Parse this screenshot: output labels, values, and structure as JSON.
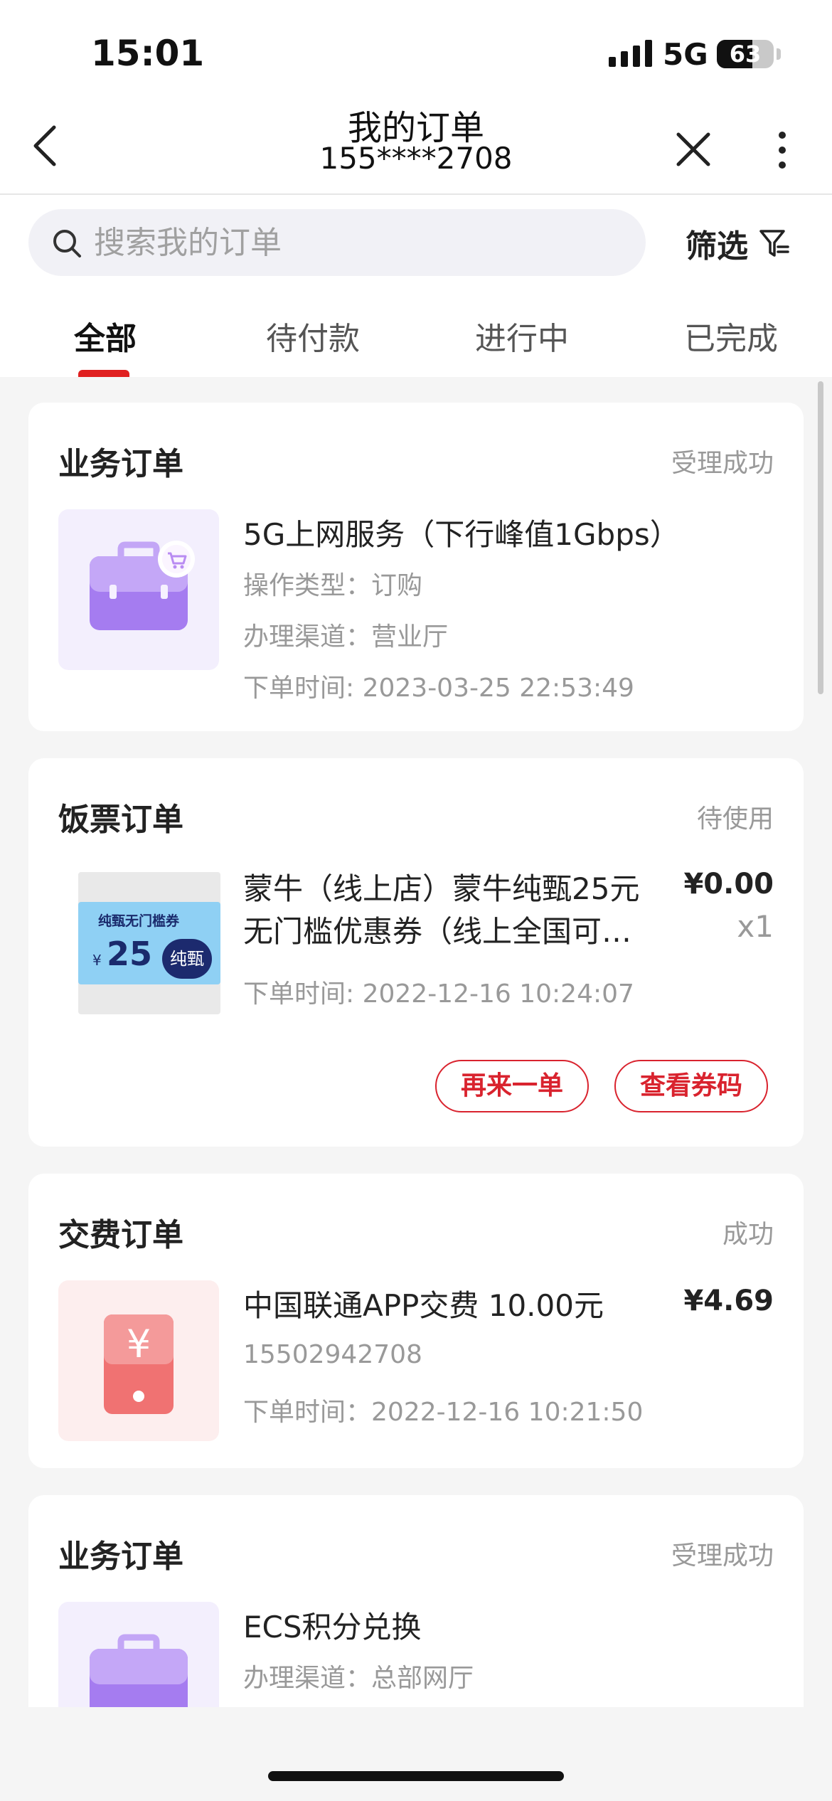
{
  "status_bar": {
    "time": "15:01",
    "network": "5G",
    "battery": "63",
    "battery_level": 0.63
  },
  "nav": {
    "title": "我的订单",
    "subtitle": "155****2708"
  },
  "search": {
    "placeholder": "搜索我的订单",
    "value": ""
  },
  "filter": {
    "label": "筛选"
  },
  "tabs": [
    {
      "label": "全部",
      "active": true
    },
    {
      "label": "待付款",
      "active": false
    },
    {
      "label": "进行中",
      "active": false
    },
    {
      "label": "已完成",
      "active": false
    }
  ],
  "orders": [
    {
      "type": "业务订单",
      "status": "受理成功",
      "icon": "briefcase-cart-icon",
      "name": "5G上网服务（下行峰值1Gbps）",
      "lines": [
        "操作类型：订购",
        "办理渠道：营业厅",
        "下单时间: 2023-03-25 22:53:49"
      ]
    },
    {
      "type": "饭票订单",
      "status": "待使用",
      "icon": "coupon-image",
      "coupon": {
        "heading": "纯甄无门槛券",
        "currency": "¥",
        "amount": "25",
        "brand": "纯甄"
      },
      "name_line1": "蒙牛（线上店）蒙牛纯甄25元",
      "name_line2": "无门槛优惠券（线上全国可…",
      "price": "¥0.00",
      "qty": "x1",
      "time": "下单时间: 2022-12-16 10:24:07",
      "buttons": [
        "再来一单",
        "查看券码"
      ]
    },
    {
      "type": "交费订单",
      "status": "成功",
      "icon": "phone-yuan-icon",
      "name": "中国联通APP交费 10.00元",
      "price": "¥4.69",
      "lines": [
        "15502942708",
        "下单时间：2022-12-16 10:21:50"
      ]
    },
    {
      "type": "业务订单",
      "status": "受理成功",
      "icon": "briefcase-icon",
      "name": "ECS积分兑换",
      "lines": [
        "办理渠道：总部网厅"
      ]
    }
  ],
  "colors": {
    "accent": "#e02020",
    "button_red": "#d9232e",
    "muted": "#999999",
    "purple": "#a77ef0",
    "pink_icon": "#f07272"
  }
}
